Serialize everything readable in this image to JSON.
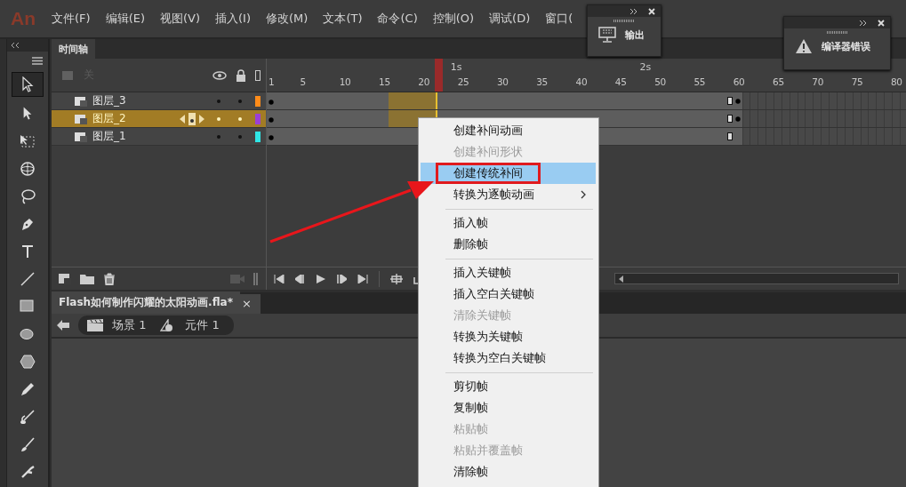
{
  "menu_bar": {
    "logo": "An",
    "items": [
      "文件(F)",
      "编辑(E)",
      "视图(V)",
      "插入(I)",
      "修改(M)",
      "文本(T)",
      "命令(C)",
      "控制(O)",
      "调试(D)",
      "窗口("
    ]
  },
  "floating_panels": [
    {
      "kind": "output",
      "title": "输出"
    },
    {
      "kind": "error",
      "title": "编译器错误"
    }
  ],
  "timeline": {
    "tab": "时间轴",
    "header_label": "关",
    "frame_numbers": [
      "1",
      "5",
      "10",
      "15",
      "20",
      "25",
      "30",
      "35",
      "40",
      "45",
      "50",
      "55",
      "60",
      "65",
      "70",
      "75",
      "80"
    ],
    "seconds": [
      "1s",
      "2s"
    ],
    "layers": [
      {
        "name": "图层_3",
        "selected": false,
        "color": "#ff8c1a",
        "tween": true
      },
      {
        "name": "图层_2",
        "selected": true,
        "color": "#9b3fd6",
        "tween": true
      },
      {
        "name": "图层_1",
        "selected": false,
        "color": "#2fe6e6",
        "tween": false
      }
    ]
  },
  "document_tab": {
    "title": "Flash如何制作闪耀的太阳动画.fla*",
    "close": "×"
  },
  "breadcrumb": [
    {
      "kind": "scene",
      "label": "场景 1"
    },
    {
      "kind": "symbol",
      "label": "元件 1"
    }
  ],
  "context_menu": {
    "items": [
      {
        "kind": "item",
        "label": "创建补间动画",
        "disabled": false,
        "selected": false,
        "submenu": false
      },
      {
        "kind": "item",
        "label": "创建补间形状",
        "disabled": true,
        "selected": false,
        "submenu": false
      },
      {
        "kind": "item",
        "label": "创建传统补间",
        "disabled": false,
        "selected": true,
        "submenu": false
      },
      {
        "kind": "item",
        "label": "转换为逐帧动画",
        "disabled": false,
        "selected": false,
        "submenu": true
      },
      {
        "kind": "separator"
      },
      {
        "kind": "item",
        "label": "插入帧",
        "disabled": false,
        "selected": false,
        "submenu": false
      },
      {
        "kind": "item",
        "label": "删除帧",
        "disabled": false,
        "selected": false,
        "submenu": false
      },
      {
        "kind": "separator"
      },
      {
        "kind": "item",
        "label": "插入关键帧",
        "disabled": false,
        "selected": false,
        "submenu": false
      },
      {
        "kind": "item",
        "label": "插入空白关键帧",
        "disabled": false,
        "selected": false,
        "submenu": false
      },
      {
        "kind": "item",
        "label": "清除关键帧",
        "disabled": true,
        "selected": false,
        "submenu": false
      },
      {
        "kind": "item",
        "label": "转换为关键帧",
        "disabled": false,
        "selected": false,
        "submenu": false
      },
      {
        "kind": "item",
        "label": "转换为空白关键帧",
        "disabled": false,
        "selected": false,
        "submenu": false
      },
      {
        "kind": "separator"
      },
      {
        "kind": "item",
        "label": "剪切帧",
        "disabled": false,
        "selected": false,
        "submenu": false
      },
      {
        "kind": "item",
        "label": "复制帧",
        "disabled": false,
        "selected": false,
        "submenu": false
      },
      {
        "kind": "item",
        "label": "粘贴帧",
        "disabled": true,
        "selected": false,
        "submenu": false
      },
      {
        "kind": "item",
        "label": "粘贴并覆盖帧",
        "disabled": true,
        "selected": false,
        "submenu": false
      },
      {
        "kind": "item",
        "label": "清除帧",
        "disabled": false,
        "selected": false,
        "submenu": false
      }
    ]
  }
}
